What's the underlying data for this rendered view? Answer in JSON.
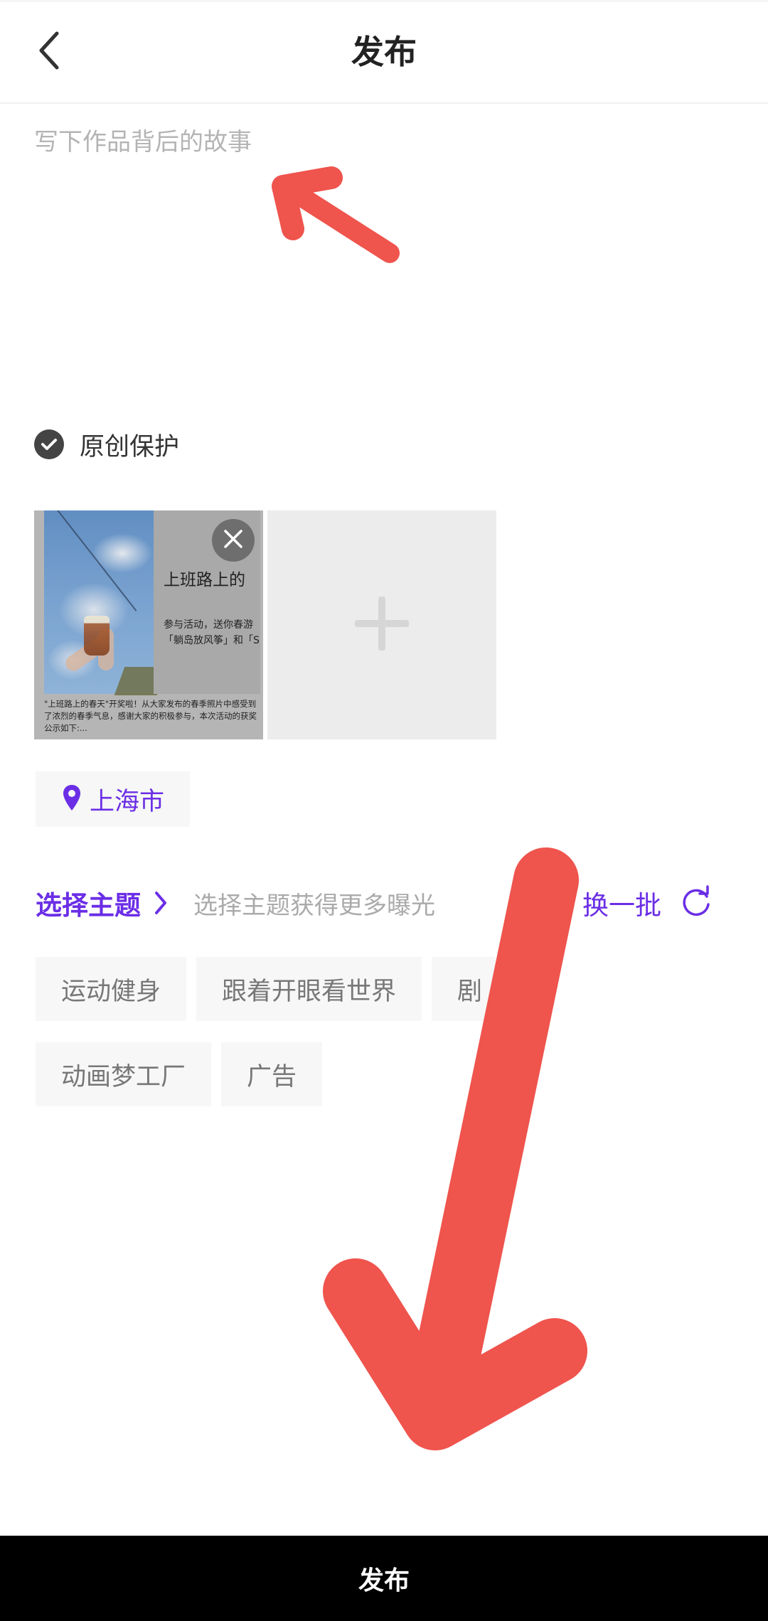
{
  "header": {
    "title": "发布",
    "back_icon": "chevron-left-icon"
  },
  "story": {
    "value": "",
    "placeholder": "写下作品背后的故事"
  },
  "original_protection": {
    "label": "原创保护",
    "checked": true
  },
  "media": {
    "items": [
      {
        "heading": "上班路上的",
        "sub_lines": [
          "参与活动，送你春游",
          "「躺岛放风筝」和「See"
        ],
        "caption": "\"上班路上的春天\"开奖啦！从大家发布的春季照片中感受到了浓烈的春季气息，感谢大家的积极参与，本次活动的获奖公示如下:..."
      }
    ],
    "add_icon": "plus-icon",
    "remove_icon": "close-icon"
  },
  "location": {
    "label": "上海市",
    "icon": "map-pin-icon"
  },
  "topics": {
    "title": "选择主题",
    "hint": "选择主题获得更多曝光",
    "refresh_label": "换一批",
    "refresh_icon": "refresh-icon",
    "rows": [
      [
        "运动健身",
        "跟着开眼看世界",
        "剧"
      ],
      [
        "动画梦工厂",
        "广告"
      ]
    ]
  },
  "footer": {
    "publish_label": "发布"
  },
  "colors": {
    "accent": "#6b2ee6",
    "annotation": "#ef544d",
    "publish_bar": "#000000",
    "tag_bg": "#f6f7f6"
  }
}
